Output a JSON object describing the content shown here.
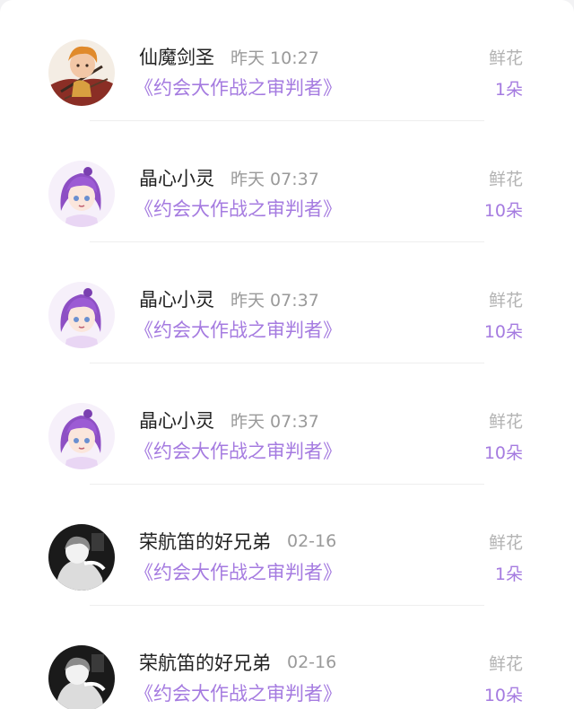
{
  "list": [
    {
      "name": "仙魔剑圣",
      "time": "昨天 10:27",
      "book": "《约会大作战之审判者》",
      "gift_label": "鲜花",
      "gift_count": "1朵",
      "avatar_icon": "warrior-avatar-icon"
    },
    {
      "name": "晶心小灵",
      "time": "昨天 07:37",
      "book": "《约会大作战之审判者》",
      "gift_label": "鲜花",
      "gift_count": "10朵",
      "avatar_icon": "purple-hair-girl-avatar-icon"
    },
    {
      "name": "晶心小灵",
      "time": "昨天 07:37",
      "book": "《约会大作战之审判者》",
      "gift_label": "鲜花",
      "gift_count": "10朵",
      "avatar_icon": "purple-hair-girl-avatar-icon"
    },
    {
      "name": "晶心小灵",
      "time": "昨天 07:37",
      "book": "《约会大作战之审判者》",
      "gift_label": "鲜花",
      "gift_count": "10朵",
      "avatar_icon": "purple-hair-girl-avatar-icon"
    },
    {
      "name": "荣航笛的好兄弟",
      "time": "02-16",
      "book": "《约会大作战之审判者》",
      "gift_label": "鲜花",
      "gift_count": "1朵",
      "avatar_icon": "monochrome-figure-avatar-icon"
    },
    {
      "name": "荣航笛的好兄弟",
      "time": "02-16",
      "book": "《约会大作战之审判者》",
      "gift_label": "鲜花",
      "gift_count": "10朵",
      "avatar_icon": "monochrome-figure-avatar-icon"
    }
  ],
  "colors": {
    "accent": "#a57be0",
    "name": "#222222",
    "muted": "#9a9a9a",
    "divider": "#eeeeee"
  }
}
